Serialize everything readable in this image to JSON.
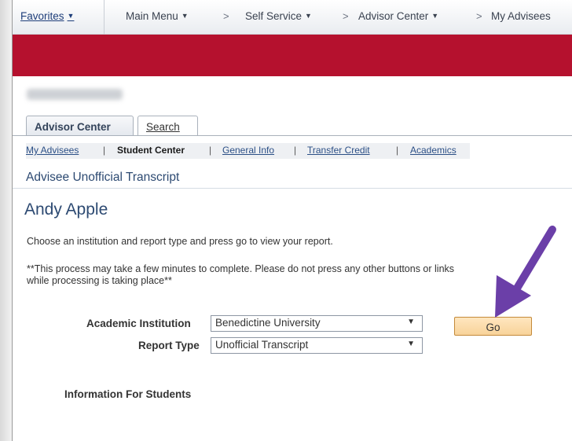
{
  "nav": {
    "favorites": "Favorites",
    "main_menu": "Main Menu",
    "self_service": "Self Service",
    "advisor_center": "Advisor Center",
    "my_advisees": "My Advisees",
    "arrow": ">",
    "caret": "▼"
  },
  "tabs": {
    "advisor_center": "Advisor Center",
    "search": "Search"
  },
  "subnav": {
    "my_advisees": "My Advisees",
    "student_center": "Student Center",
    "general_info": "General Info",
    "transfer_credit": "Transfer Credit",
    "academics": "Academics",
    "pipe": "|"
  },
  "page": {
    "subtitle": "Advisee Unofficial Transcript",
    "student_name": "Andy Apple",
    "instructions": "Choose an institution and report type and press go to view your report.",
    "warning": "**This process may take a few minutes to complete. Please do not press any other buttons or links while processing is taking place**"
  },
  "form": {
    "institution_label": "Academic Institution",
    "institution_value": "Benedictine University",
    "report_type_label": "Report Type",
    "report_type_value": "Unofficial Transcript",
    "go_label": "Go"
  },
  "info_heading": "Information For Students",
  "colors": {
    "brand_red": "#b5112e",
    "annotation_arrow": "#6b3fa8",
    "go_button": "#fbd9a4"
  }
}
